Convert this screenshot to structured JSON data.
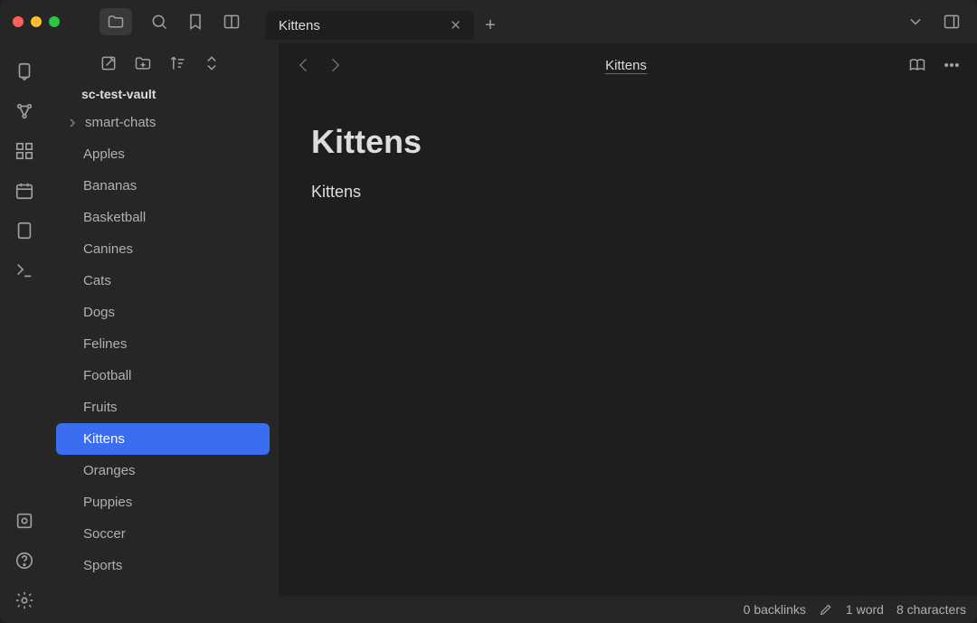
{
  "tab": {
    "label": "Kittens"
  },
  "vault": {
    "name": "sc-test-vault"
  },
  "folder": {
    "name": "smart-chats"
  },
  "files": [
    {
      "name": "Apples",
      "active": false
    },
    {
      "name": "Bananas",
      "active": false
    },
    {
      "name": "Basketball",
      "active": false
    },
    {
      "name": "Canines",
      "active": false
    },
    {
      "name": "Cats",
      "active": false
    },
    {
      "name": "Dogs",
      "active": false
    },
    {
      "name": "Felines",
      "active": false
    },
    {
      "name": "Football",
      "active": false
    },
    {
      "name": "Fruits",
      "active": false
    },
    {
      "name": "Kittens",
      "active": true
    },
    {
      "name": "Oranges",
      "active": false
    },
    {
      "name": "Puppies",
      "active": false
    },
    {
      "name": "Soccer",
      "active": false
    },
    {
      "name": "Sports",
      "active": false
    }
  ],
  "breadcrumb": "Kittens",
  "note": {
    "title": "Kittens",
    "content": "Kittens"
  },
  "status": {
    "backlinks": "0 backlinks",
    "word_count": "1 word",
    "char_count": "8 characters"
  }
}
